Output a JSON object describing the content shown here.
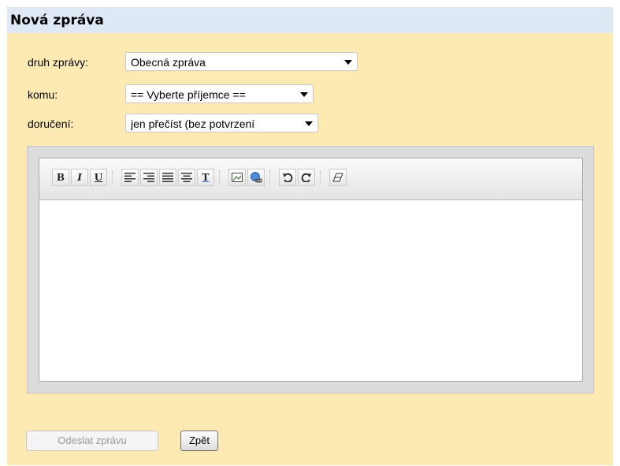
{
  "header": {
    "title": "Nová zpráva"
  },
  "form": {
    "type_label": "druh zprávy:",
    "type_value": "Obecná zpráva",
    "to_label": "komu:",
    "to_value": "== Vyberte příjemce ==",
    "delivery_label": "doručení:",
    "delivery_value": "jen přečíst (bez potvrzení"
  },
  "toolbar": {
    "buttons": [
      "B",
      "I",
      "U",
      "T"
    ]
  },
  "buttons": {
    "send_label": "Odeslat zprávu",
    "back_label": "Zpět"
  }
}
